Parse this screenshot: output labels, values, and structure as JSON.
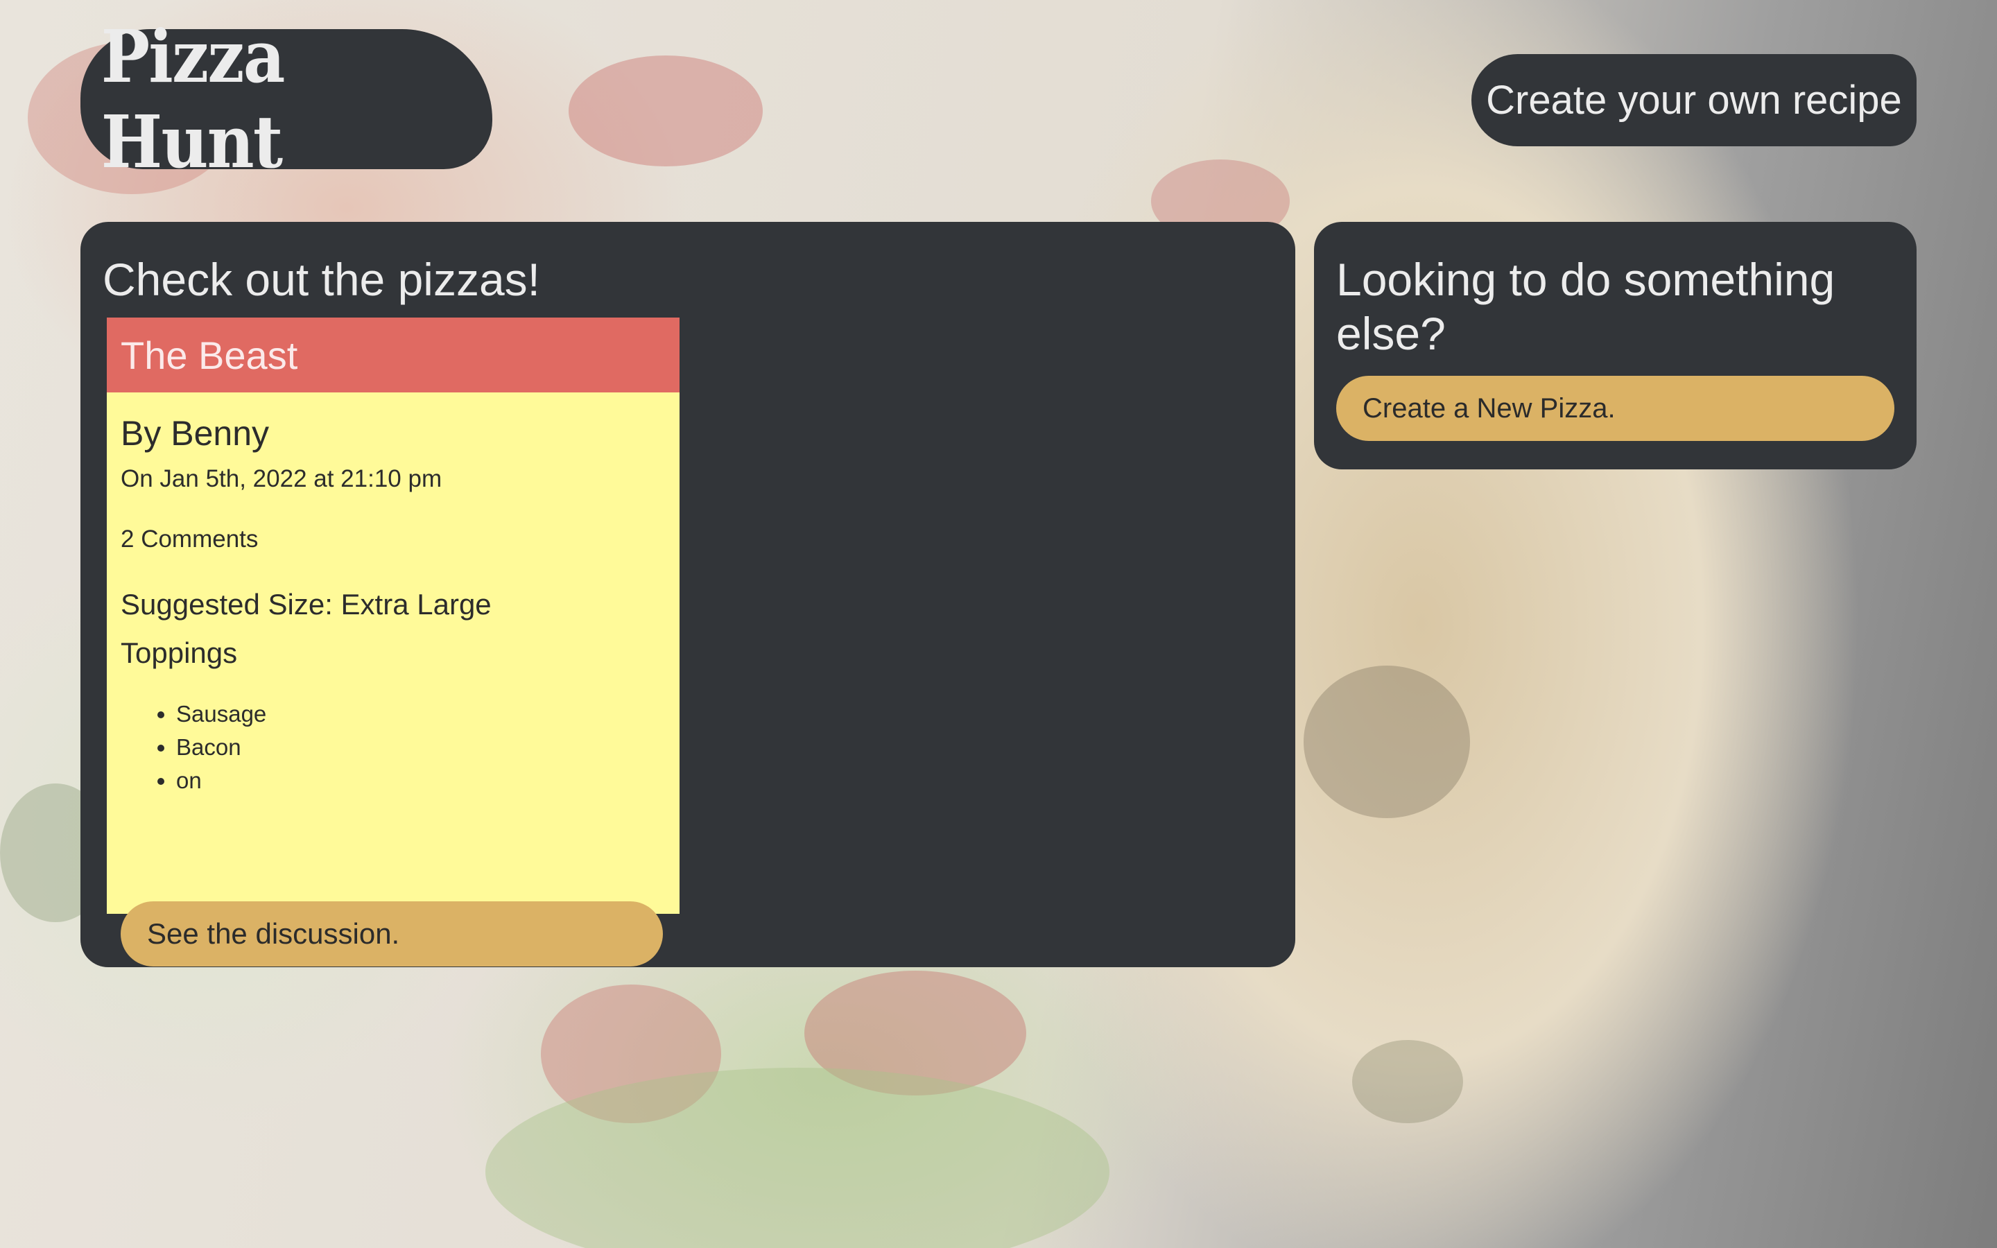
{
  "header": {
    "logo_text": "Pizza Hunt",
    "create_recipe_label": "Create your own recipe"
  },
  "main": {
    "title": "Check out the pizzas!",
    "pizzas": [
      {
        "name": "The Beast",
        "author": "By Benny",
        "date": "On Jan 5th, 2022 at 21:10 pm",
        "comments": "2 Comments",
        "size": "Suggested Size: Extra Large",
        "toppings_label": "Toppings",
        "toppings": [
          "Sausage",
          "Bacon",
          "on"
        ],
        "discussion_label": "See the discussion."
      }
    ]
  },
  "side": {
    "title": "Looking to do something else?",
    "new_pizza_label": "Create a New Pizza."
  },
  "colors": {
    "panel_bg": "#323539",
    "card_bg": "#fffa99",
    "card_header_bg": "#e06a62",
    "button_bg": "#dbb265"
  }
}
